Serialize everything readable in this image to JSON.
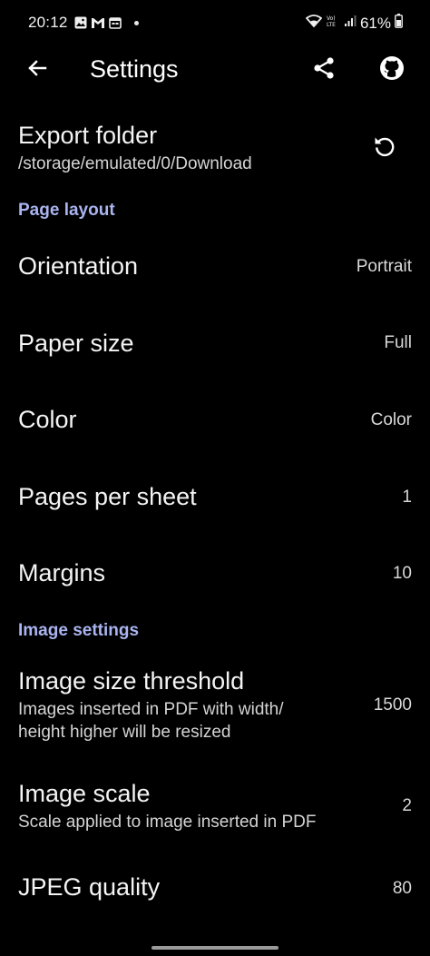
{
  "status_bar": {
    "time": "20:12",
    "battery": "61%",
    "icons_left": [
      "photo-icon",
      "gmail-icon",
      "calendar-icon"
    ],
    "icons_right": [
      "wifi-icon",
      "volte-icon",
      "signal-icon",
      "battery-icon"
    ]
  },
  "app_bar": {
    "title": "Settings",
    "back_icon": "arrow-left-icon",
    "actions": [
      "share-icon",
      "github-icon"
    ]
  },
  "export_folder": {
    "title": "Export folder",
    "path": "/storage/emulated/0/Download",
    "action_icon": "reset-icon"
  },
  "sections": {
    "page_layout": {
      "header": "Page layout",
      "items": [
        {
          "title": "Orientation",
          "value": "Portrait"
        },
        {
          "title": "Paper size",
          "value": "Full"
        },
        {
          "title": "Color",
          "value": "Color"
        },
        {
          "title": "Pages per sheet",
          "value": "1"
        },
        {
          "title": "Margins",
          "value": "10"
        }
      ]
    },
    "image_settings": {
      "header": "Image settings",
      "items": [
        {
          "title": "Image size threshold",
          "subtitle_line1": "Images inserted in PDF with width/",
          "subtitle_line2": "height higher will be resized",
          "value": "1500"
        },
        {
          "title": "Image scale",
          "subtitle": "Scale applied to image inserted in PDF",
          "value": "2"
        },
        {
          "title": "JPEG quality",
          "value": "80"
        }
      ]
    }
  }
}
